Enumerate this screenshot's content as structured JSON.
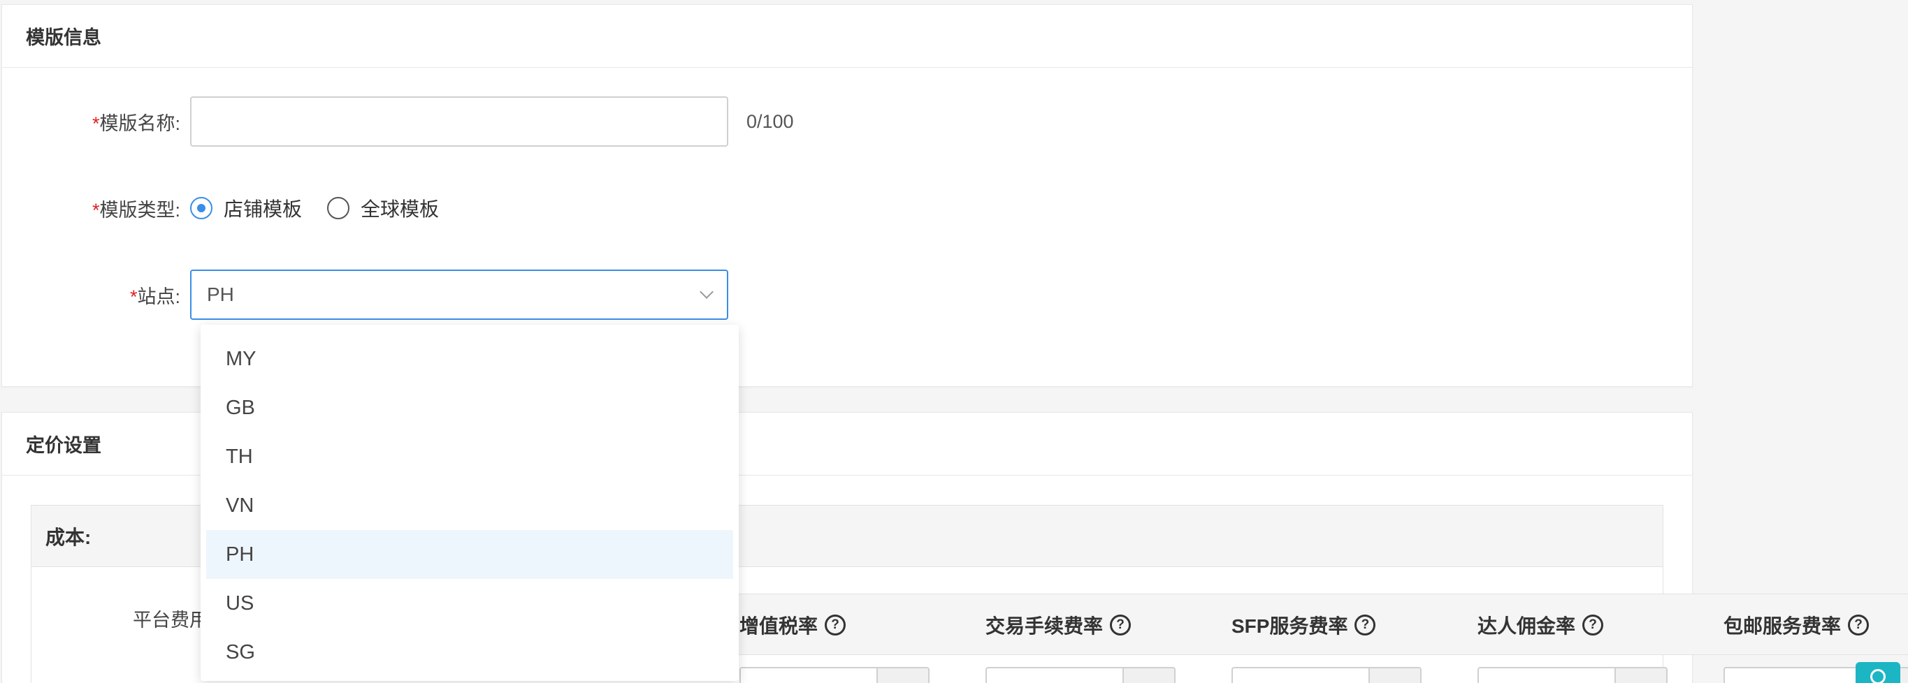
{
  "template_info": {
    "title": "模版信息",
    "name_label": "模版名称:",
    "name_value": "",
    "name_placeholder": "",
    "counter": "0/100",
    "type_label": "模版类型:",
    "type_options": [
      "店铺模板",
      "全球模板"
    ],
    "type_selected": "店铺模板",
    "site_label": "站点:",
    "site_value": "PH",
    "required_mark": "*"
  },
  "site_dropdown": {
    "options": [
      "MY",
      "GB",
      "TH",
      "VN",
      "PH",
      "US",
      "SG"
    ],
    "selected": "PH"
  },
  "pricing": {
    "title": "定价设置",
    "cost_label": "成本:",
    "platform_fee_label": "平台费用",
    "fee_columns": [
      "增值税率",
      "交易手续费率",
      "SFP服务费率",
      "达人佣金率",
      "包邮服务费率"
    ],
    "help_glyph": "?"
  },
  "colors": {
    "accent": "#3a8ee6",
    "required": "#e02020",
    "selected_bg": "#eef6fd",
    "badge": "#1cb5c4"
  }
}
